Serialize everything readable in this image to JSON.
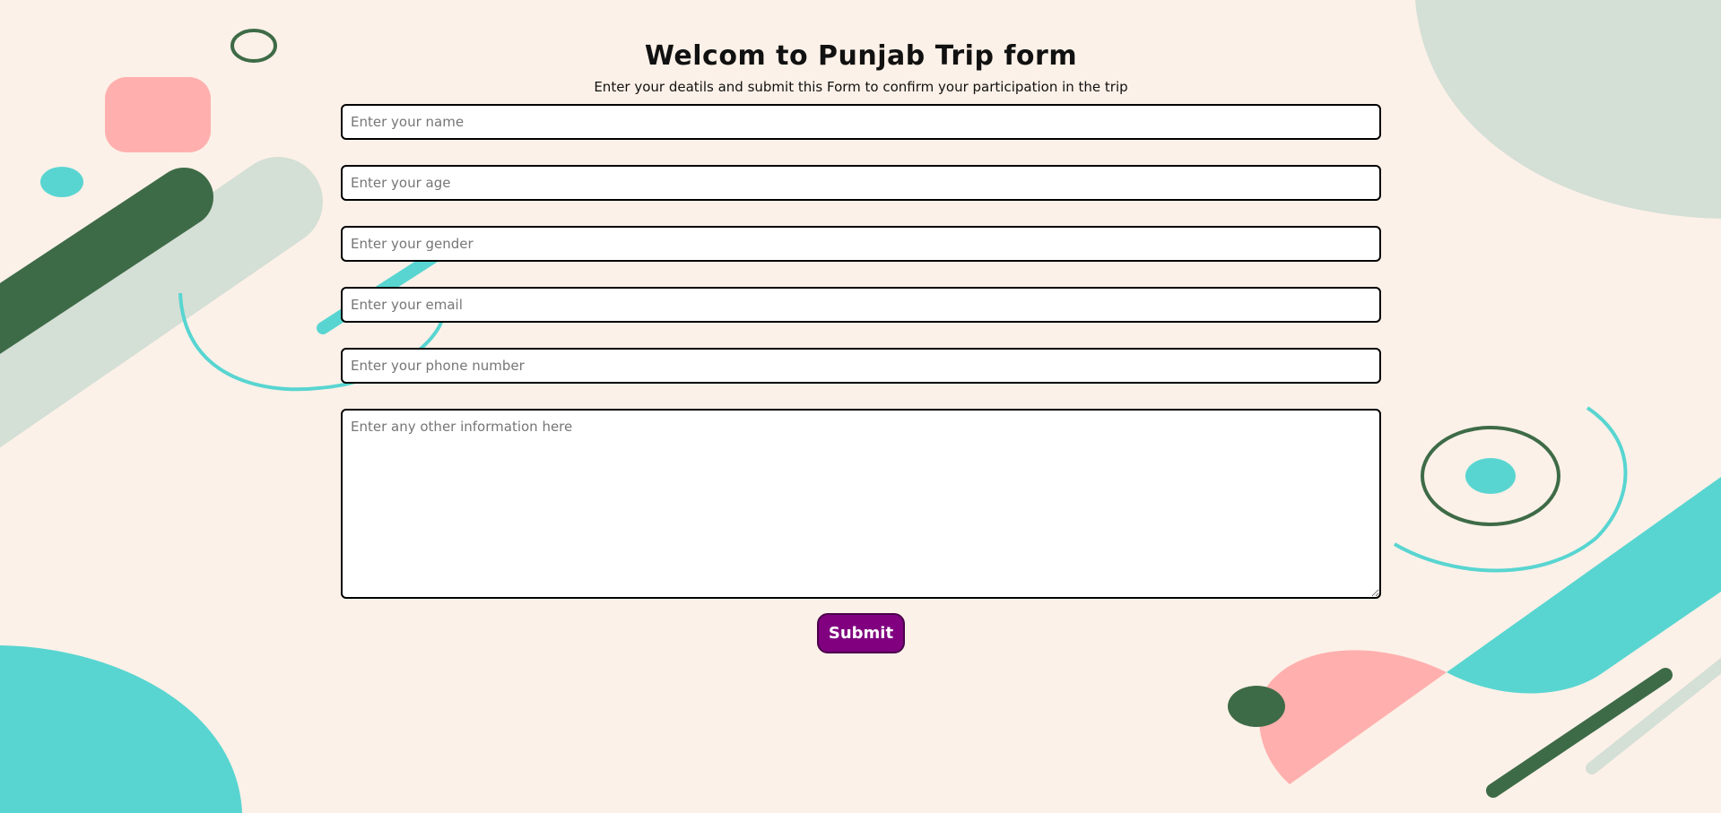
{
  "form": {
    "title": "Welcom to Punjab Trip form",
    "subtitle": "Enter your deatils and submit this Form to confirm your participation in the trip",
    "fields": {
      "name": {
        "placeholder": "Enter your name",
        "value": ""
      },
      "age": {
        "placeholder": "Enter your age",
        "value": ""
      },
      "gender": {
        "placeholder": "Enter your gender",
        "value": ""
      },
      "email": {
        "placeholder": "Enter your email",
        "value": ""
      },
      "phone": {
        "placeholder": "Enter your phone number",
        "value": ""
      },
      "other": {
        "placeholder": "Enter any other information here",
        "value": ""
      }
    },
    "submit_label": "Submit"
  },
  "colors": {
    "background": "#fcf1e8",
    "dark_green": "#3e6b47",
    "light_sage": "#d4dfd6",
    "turquoise": "#58d5d1",
    "pink": "#ffb0ae",
    "submit_purple": "#800080"
  }
}
